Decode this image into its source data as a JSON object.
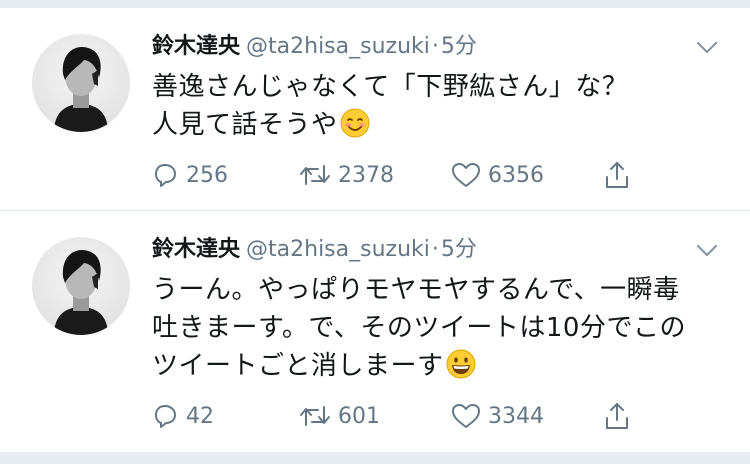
{
  "tweets": [
    {
      "author_name": "鈴木達央",
      "handle": "@ta2hisa_suzuki",
      "separator": "·",
      "time": "5分",
      "text_lines": [
        "善逸さんじゃなくて「下野紘さん」な？",
        "人見て話そうや"
      ],
      "emoji": "smiling-face-icon",
      "replies": "256",
      "retweets": "2378",
      "likes": "6356"
    },
    {
      "author_name": "鈴木達央",
      "handle": "@ta2hisa_suzuki",
      "separator": "·",
      "time": "5分",
      "text_lines": [
        "うーん。やっぱりモヤモヤするんで、一瞬毒",
        "吐きまーす。で、そのツイートは10分でこの",
        "ツイートごと消しまーす"
      ],
      "emoji": "grinning-face-icon",
      "replies": "42",
      "retweets": "601",
      "likes": "3344"
    }
  ],
  "colors": {
    "text": "#14171a",
    "secondary": "#657786",
    "divider": "#e1e8ed",
    "page_background": "#e6ecf0"
  }
}
